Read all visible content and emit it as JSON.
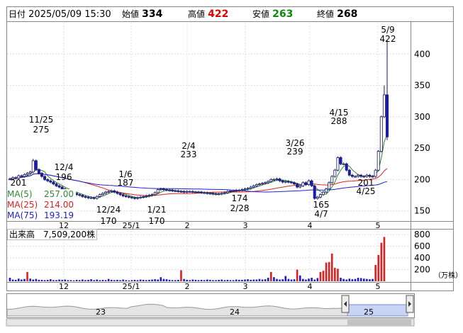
{
  "header": {
    "date_label": "日付",
    "datetime": "2025/05/09 15:30",
    "open_label": "始値",
    "open": "334",
    "high_label": "高値",
    "high": "422",
    "low_label": "安値",
    "low": "263",
    "close_label": "終値",
    "close": "268"
  },
  "colors": {
    "up": "#ffffff",
    "down": "#1a1acc",
    "vol_up": "#e02020",
    "vol_down": "#1a1acc",
    "ma5": "#2e8b2e",
    "ma25": "#e02020",
    "ma75": "#2020d0",
    "high_text": "#e00000",
    "low_text": "#0a8a0a"
  },
  "ma_legend": [
    {
      "name": "MA(5)",
      "value": "257.00",
      "color": "#2e8b2e"
    },
    {
      "name": "MA(25)",
      "value": "214.00",
      "color": "#e02020"
    },
    {
      "name": "MA(75)",
      "value": "193.19",
      "color": "#2020d0"
    }
  ],
  "volume_label": "出来高　7,509,200株",
  "volume_unit": "（万株）",
  "chart_data": {
    "type": "candlestick",
    "price_axis_ticks": [
      150,
      200,
      250,
      300,
      350,
      400
    ],
    "price_ylim": [
      135,
      450
    ],
    "volume_axis_ticks": [
      200,
      400,
      600,
      800
    ],
    "volume_ylim": [
      0,
      850
    ],
    "x_tick_labels": [
      "12",
      "25/1",
      "2",
      "3",
      "4",
      "5"
    ],
    "annotations": [
      {
        "label": "201",
        "value": 201,
        "kind": "low"
      },
      {
        "label": "11/25",
        "label2": "275",
        "value": 275,
        "kind": "high"
      },
      {
        "label": "12/4",
        "label2": "196",
        "value": 196,
        "kind": "low"
      },
      {
        "label": "170",
        "label2": "12/24",
        "value": 170,
        "kind": "low"
      },
      {
        "label": "1/6",
        "label2": "187",
        "value": 187,
        "kind": "high"
      },
      {
        "label": "170",
        "label2": "1/21",
        "value": 170,
        "kind": "low"
      },
      {
        "label": "2/4",
        "label2": "233",
        "value": 233,
        "kind": "high"
      },
      {
        "label": "174",
        "label2": "2/28",
        "value": 174,
        "kind": "low"
      },
      {
        "label": "3/26",
        "label2": "239",
        "value": 239,
        "kind": "high"
      },
      {
        "label": "165",
        "label2": "4/7",
        "value": 165,
        "kind": "low"
      },
      {
        "label": "4/15",
        "label2": "288",
        "value": 288,
        "kind": "high"
      },
      {
        "label": "201",
        "label2": "4/25",
        "value": 201,
        "kind": "low"
      },
      {
        "label": "5/9",
        "label2": "422",
        "value": 422,
        "kind": "high"
      }
    ],
    "closes": [
      201,
      203,
      202,
      206,
      205,
      208,
      210,
      212,
      230,
      216,
      210,
      205,
      200,
      198,
      196,
      193,
      190,
      188,
      185,
      183,
      182,
      180,
      178,
      176,
      175,
      173,
      172,
      171,
      171,
      170,
      173,
      176,
      178,
      180,
      181,
      182,
      180,
      178,
      176,
      174,
      173,
      172,
      171,
      170,
      171,
      172,
      173,
      174,
      175,
      176,
      179,
      184,
      185,
      184,
      183,
      183,
      182,
      182,
      181,
      181,
      180,
      181,
      181,
      180,
      180,
      180,
      179,
      179,
      178,
      178,
      177,
      177,
      177,
      178,
      179,
      181,
      182,
      182,
      183,
      183,
      184,
      185,
      186,
      188,
      190,
      192,
      193,
      194,
      195,
      197,
      200,
      200,
      201,
      198,
      196,
      197,
      196,
      195,
      193,
      188,
      190,
      195,
      192,
      198,
      190,
      170,
      172,
      176,
      180,
      185,
      195,
      205,
      215,
      235,
      225,
      225,
      215,
      207,
      205,
      205,
      207,
      205,
      205,
      207,
      205,
      205,
      215,
      245,
      300,
      335,
      268
    ],
    "volumes": [
      60,
      30,
      25,
      45,
      30,
      40,
      160,
      45,
      30,
      40,
      25,
      25,
      20,
      25,
      35,
      20,
      20,
      30,
      25,
      30,
      20,
      20,
      15,
      25,
      20,
      30,
      20,
      25,
      35,
      20,
      30,
      20,
      25,
      20,
      40,
      25,
      20,
      25,
      20,
      30,
      20,
      15,
      20,
      25,
      20,
      30,
      25,
      20,
      25,
      30,
      35,
      30,
      70,
      40,
      35,
      25,
      20,
      20,
      25,
      190,
      40,
      25,
      20,
      30,
      25,
      20,
      25,
      20,
      30,
      25,
      20,
      20,
      25,
      30,
      20,
      25,
      20,
      20,
      30,
      25,
      25,
      30,
      35,
      25,
      30,
      30,
      40,
      30,
      35,
      60,
      160,
      70,
      40,
      30,
      35,
      90,
      40,
      30,
      35,
      200,
      100,
      40,
      30,
      45,
      60,
      30,
      55,
      160,
      180,
      320,
      330,
      475,
      230,
      215,
      60,
      40,
      30,
      45,
      35,
      40,
      60,
      55,
      45,
      40,
      35,
      40,
      280,
      450,
      660,
      760
    ],
    "volume_colors_up": true
  },
  "navigator": {
    "labels": [
      "23",
      "24",
      "25"
    ]
  }
}
